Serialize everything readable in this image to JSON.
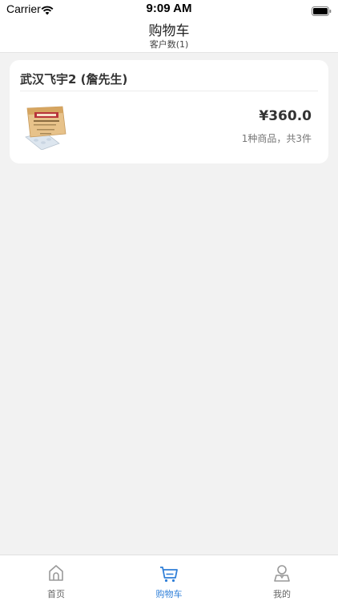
{
  "status_bar": {
    "carrier": "Carrier",
    "time": "9:09 AM"
  },
  "header": {
    "title": "购物车",
    "subtitle": "客户数(1)"
  },
  "cart": {
    "customer": "武汉飞宇2 (詹先生)",
    "price": "¥360.0",
    "summary": "1种商品，共3件",
    "product_icon": "medicine-box-icon"
  },
  "tabs": [
    {
      "label": "首页",
      "icon": "home-icon",
      "active": false
    },
    {
      "label": "购物车",
      "icon": "cart-icon",
      "active": true
    },
    {
      "label": "我的",
      "icon": "user-icon",
      "active": false
    }
  ],
  "colors": {
    "accent": "#2f7fd8",
    "background": "#f2f2f2"
  }
}
